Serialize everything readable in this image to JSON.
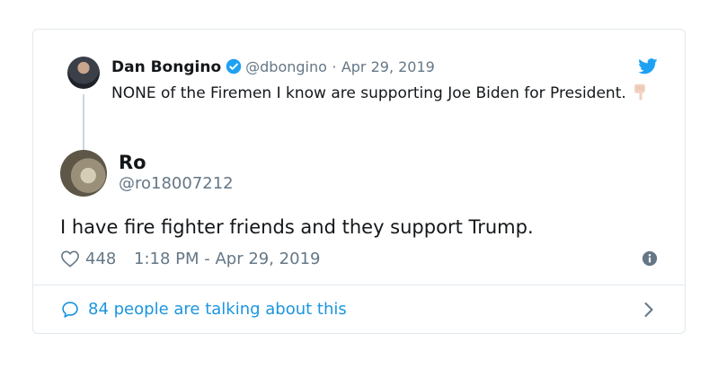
{
  "parent_tweet": {
    "author_name": "Dan Bongino",
    "handle": "@dbongino",
    "separator": "·",
    "date": "Apr 29, 2019",
    "text": "NONE of the Firemen I know are supporting Joe Biden for President.",
    "emoji_icon": "backhand-index-pointing-down-icon"
  },
  "tweet": {
    "author_name": "Ro",
    "handle": "@ro18007212",
    "text": "I have fire fighter friends and they support Trump.",
    "like_count": "448",
    "timestamp": "1:18 PM - Apr 29, 2019"
  },
  "footer": {
    "talking_text": "84 people are talking about this"
  },
  "colors": {
    "twitter_blue": "#1da1f2",
    "link_blue": "#1b95e0",
    "muted": "#657786",
    "border": "#e1e8ed"
  }
}
